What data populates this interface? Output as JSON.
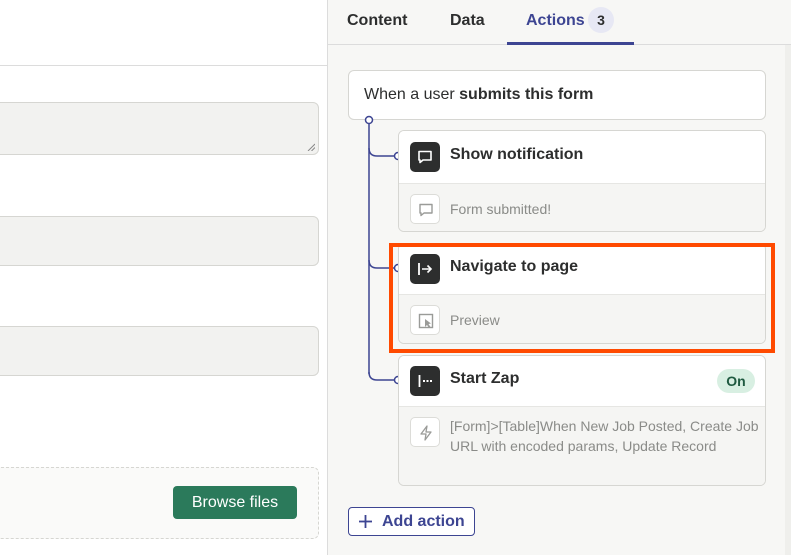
{
  "form": {
    "browse_label": "Browse files"
  },
  "panel": {
    "tabs": [
      {
        "label": "Content"
      },
      {
        "label": "Data"
      },
      {
        "label": "Actions",
        "badge": "3",
        "active": true
      }
    ],
    "trigger": {
      "prefix": "When a user ",
      "emphasis": "submits this form"
    },
    "actions": [
      {
        "title": "Show notification",
        "icon": "message-icon",
        "body_icon": "message-outline-icon",
        "body": "Form submitted!"
      },
      {
        "title": "Navigate to page",
        "icon": "arrow-to-line-icon",
        "body_icon": "page-cursor-icon",
        "body": "Preview",
        "highlighted": true
      },
      {
        "title": "Start Zap",
        "icon": "zap-step-icon",
        "body_icon": "lightning-icon",
        "status": "On",
        "body": "[Form]>[Table]When New Job Posted, Create Job URL with encoded params, Update Record"
      }
    ],
    "add_action_label": "Add action"
  },
  "colors": {
    "accent": "#3d4592",
    "highlight": "#ff4a00",
    "button_green": "#2b7a5b",
    "on_badge_bg": "#d8efe2"
  }
}
